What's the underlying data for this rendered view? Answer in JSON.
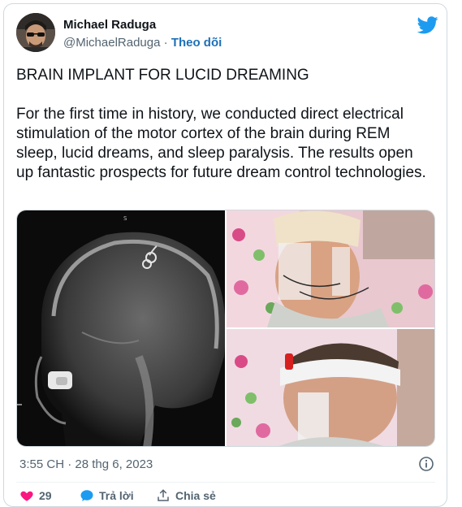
{
  "tweet": {
    "author_name": "Michael Raduga",
    "author_handle": "@MichaelRaduga",
    "separator": "·",
    "follow_label": "Theo dõi",
    "headline": "BRAIN IMPLANT FOR LUCID DREAMING",
    "body": "For the first time in history, we conducted direct electrical stimulation of the motor cortex of the brain during REM sleep, lucid dreams, and sleep paralysis. The results open up fantastic prospects for future dream control technologies.",
    "timestamp": "3:55 CH · 28 thg 6, 2023",
    "xray_marker": "S"
  },
  "actions": {
    "like_count": "29",
    "reply_label": "Trả lời",
    "share_label": "Chia sẻ"
  },
  "colors": {
    "accent_blue": "#1d9bf0",
    "follow_blue": "#1d70b8",
    "like_red": "#f91880"
  },
  "icons": {
    "logo": "twitter-bird-icon",
    "info": "info-icon",
    "like": "heart-icon",
    "reply": "reply-bubble-icon",
    "share": "share-icon"
  }
}
